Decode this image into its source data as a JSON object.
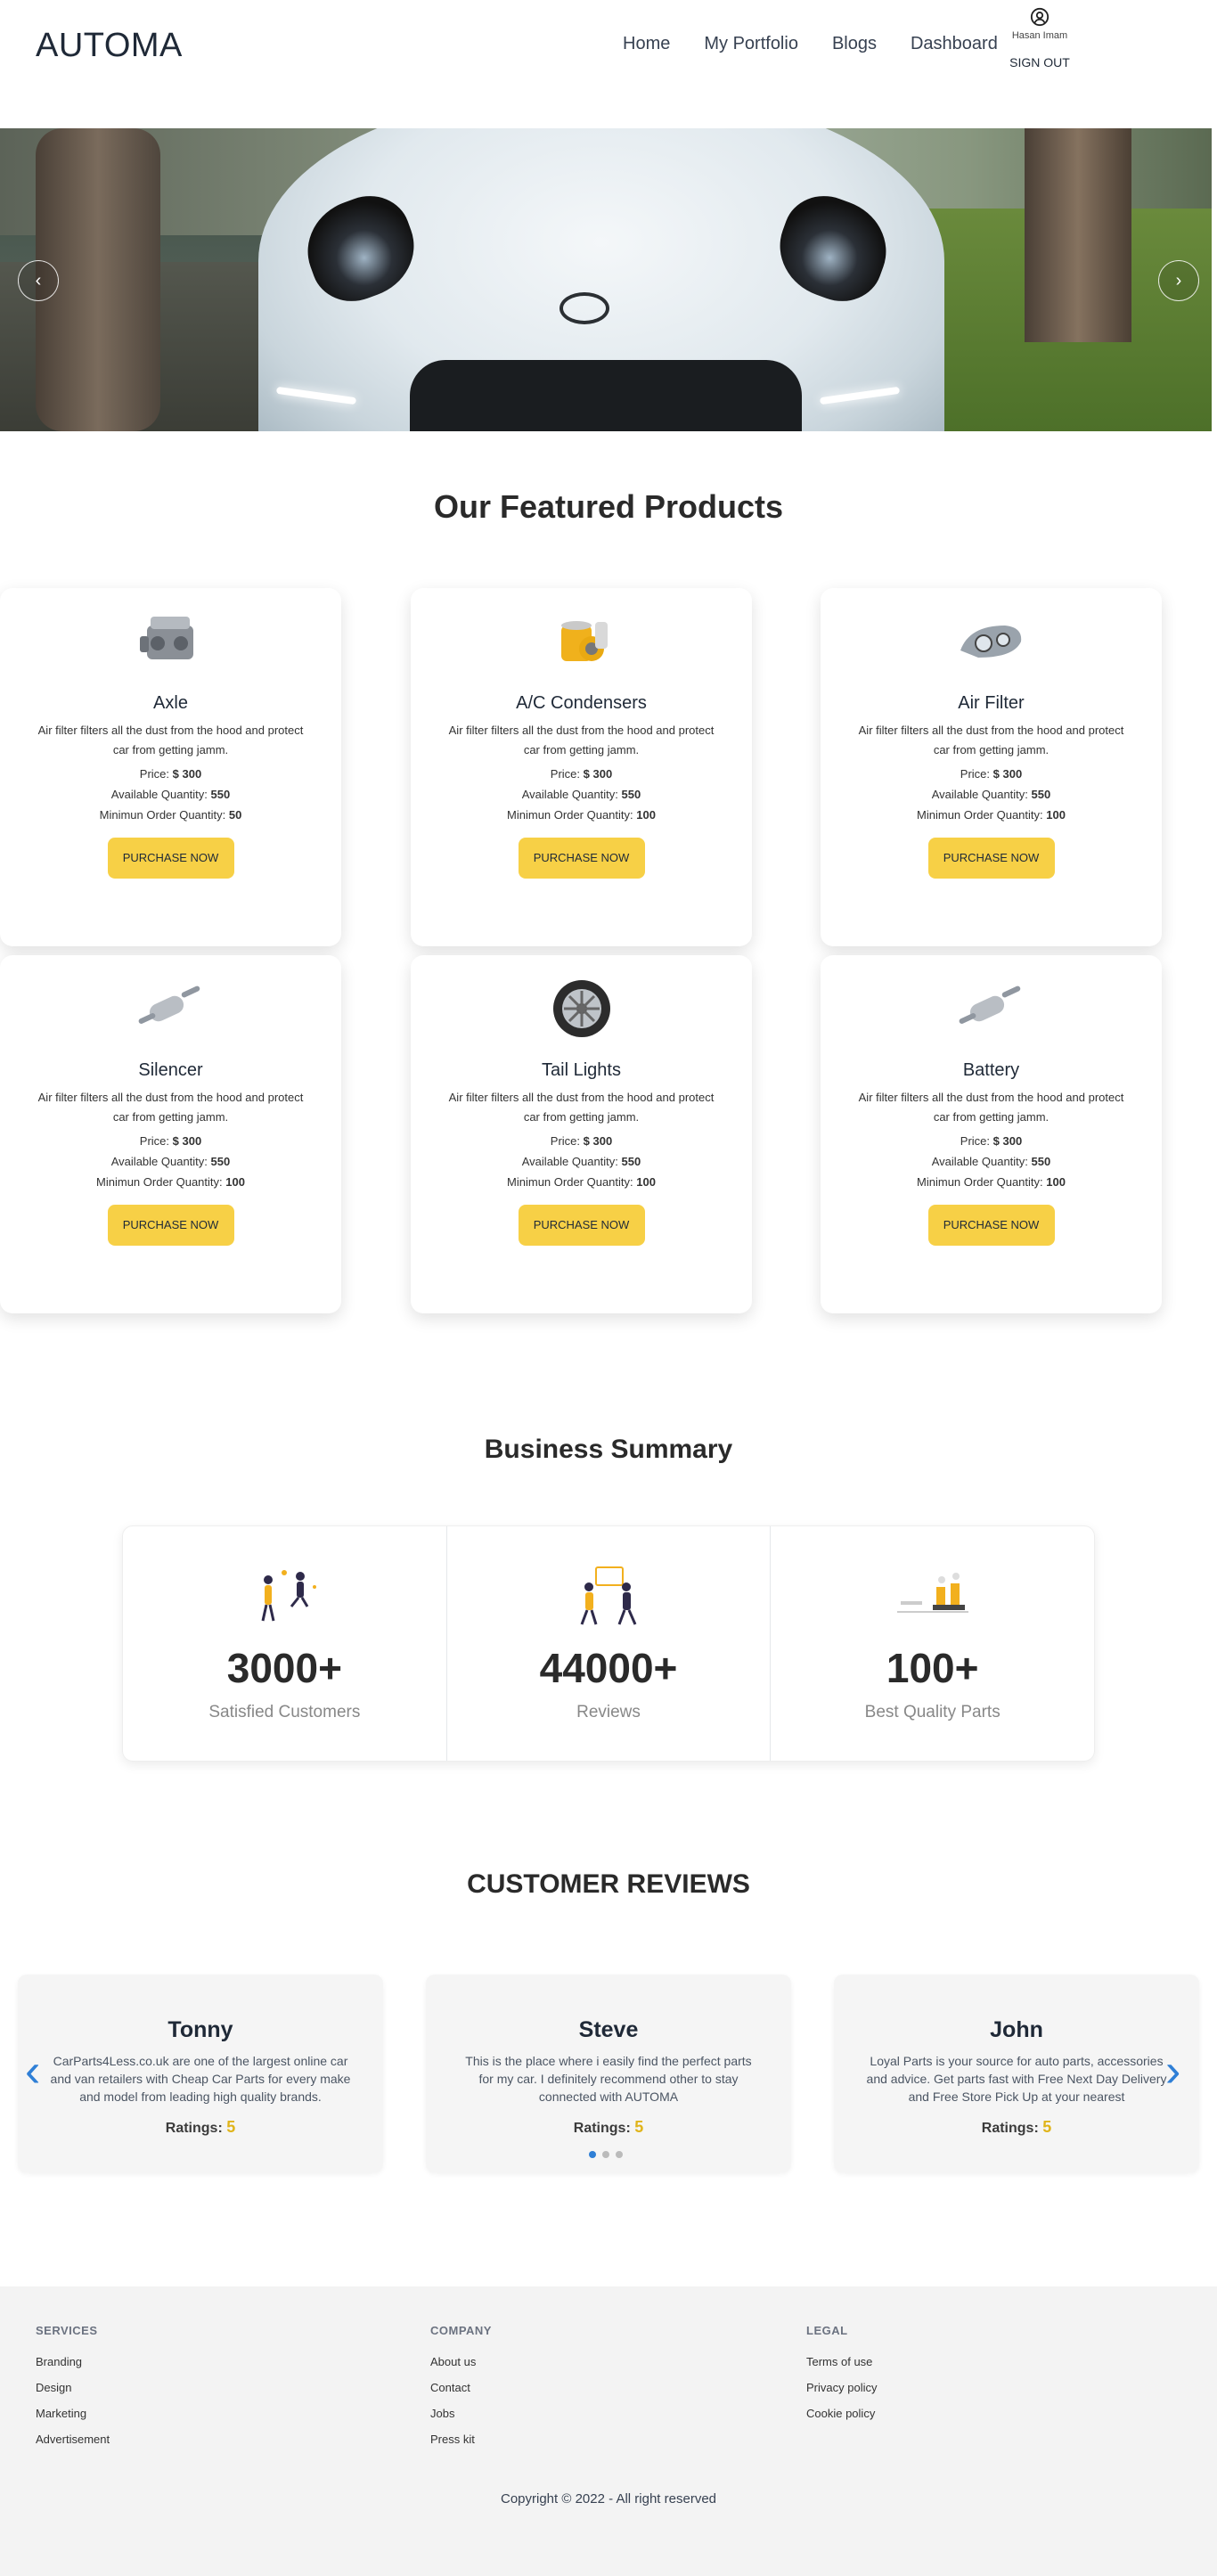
{
  "navbar": {
    "brand": "AUTOMA",
    "links": [
      "Home",
      "My Portfolio",
      "Blogs",
      "Dashboard"
    ],
    "user_name": "Hasan Imam",
    "signout": "SIGN OUT"
  },
  "hero": {
    "prev_label": "‹",
    "next_label": "›"
  },
  "featured": {
    "title": "Our Featured Products",
    "price_label": "Price:",
    "qty_label": "Available Quantity:",
    "min_label": "Minimun Order Quantity:",
    "button_label": "PURCHASE NOW",
    "products": [
      {
        "name": "Axle",
        "icon": "engine-icon",
        "desc": "Air filter filters all the dust from the hood and protect car from getting jamm.",
        "price": "$ 300",
        "qty": "550",
        "min": "50"
      },
      {
        "name": "A/C Condensers",
        "icon": "ac-condenser-icon",
        "desc": "Air filter filters all the dust from the hood and protect car from getting jamm.",
        "price": "$ 300",
        "qty": "550",
        "min": "100"
      },
      {
        "name": "Air Filter",
        "icon": "headlight-icon",
        "desc": "Air filter filters all the dust from the hood and protect car from getting jamm.",
        "price": "$ 300",
        "qty": "550",
        "min": "100"
      },
      {
        "name": "Silencer",
        "icon": "silencer-icon",
        "desc": "Air filter filters all the dust from the hood and protect car from getting jamm.",
        "price": "$ 300",
        "qty": "550",
        "min": "100"
      },
      {
        "name": "Tail Lights",
        "icon": "tire-icon",
        "desc": "Air filter filters all the dust from the hood and protect car from getting jamm.",
        "price": "$ 300",
        "qty": "550",
        "min": "100"
      },
      {
        "name": "Battery",
        "icon": "silencer-icon",
        "desc": "Air filter filters all the dust from the hood and protect car from getting jamm.",
        "price": "$ 300",
        "qty": "550",
        "min": "100"
      }
    ]
  },
  "summary": {
    "title": "Business Summary",
    "items": [
      {
        "value": "3000+",
        "label": "Satisfied Customers",
        "icon": "celebrating-people-icon"
      },
      {
        "value": "44000+",
        "label": "Reviews",
        "icon": "people-reviewing-icon"
      },
      {
        "value": "100+",
        "label": "Best Quality Parts",
        "icon": "factory-icon"
      }
    ]
  },
  "reviews": {
    "title": "CUSTOMER REVIEWS",
    "rating_label": "Ratings:",
    "items": [
      {
        "name": "Tonny",
        "text": "CarParts4Less.co.uk are one of the largest online car and van retailers with Cheap Car Parts for every make and model from leading high quality brands.",
        "rating": "5"
      },
      {
        "name": "Steve",
        "text": "This is the place where i easily find the perfect parts for my car. I definitely recommend other to stay connected with AUTOMA",
        "rating": "5"
      },
      {
        "name": "John",
        "text": "Loyal Parts is your source for auto parts, accessories and advice. Get parts fast with Free Next Day Delivery and Free Store Pick Up at your nearest",
        "rating": "5"
      }
    ],
    "prev_label": "‹",
    "next_label": "›"
  },
  "footer": {
    "services": {
      "heading": "SERVICES",
      "links": [
        "Branding",
        "Design",
        "Marketing",
        "Advertisement"
      ]
    },
    "company": {
      "heading": "COMPANY",
      "links": [
        "About us",
        "Contact",
        "Jobs",
        "Press kit"
      ]
    },
    "legal": {
      "heading": "LEGAL",
      "links": [
        "Terms of use",
        "Privacy policy",
        "Cookie policy"
      ]
    },
    "copyright": "Copyright © 2022 - All right reserved"
  },
  "colors": {
    "accent_button": "#f7d046",
    "rating_number": "#e0b41a",
    "carousel_arrow": "#2f7fd6"
  }
}
